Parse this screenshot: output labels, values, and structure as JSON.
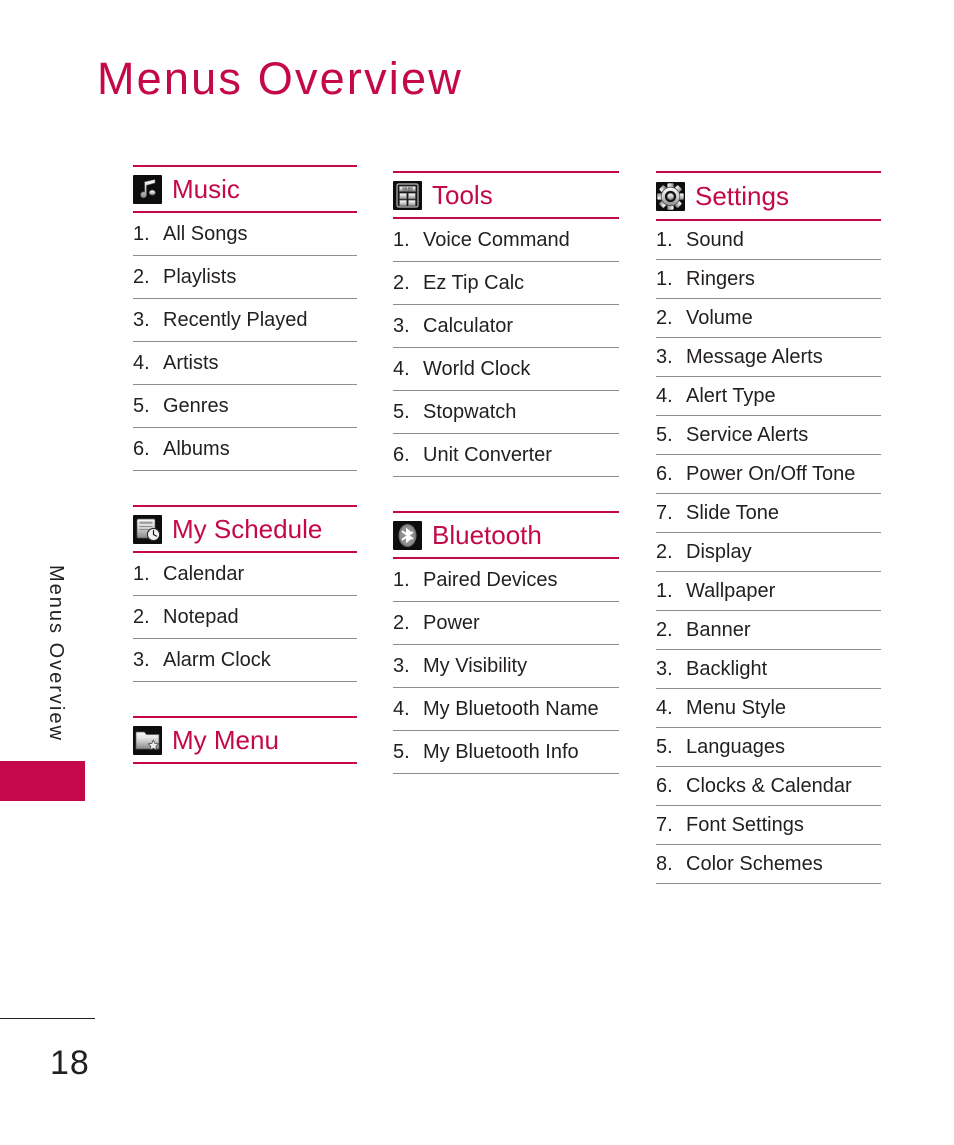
{
  "page": {
    "title": "Menus Overview",
    "running_head": "Menus Overview",
    "page_number": "18",
    "accent_color": "#C4084A",
    "text_color": "#231F20",
    "rule_color": "#8E8E8E"
  },
  "columns": [
    {
      "id": "column-1",
      "sections": [
        {
          "id": "music",
          "title": "Music",
          "icon": "music-note-icon",
          "items": [
            {
              "num": "1.",
              "label": "All Songs"
            },
            {
              "num": "2.",
              "label": "Playlists"
            },
            {
              "num": "3.",
              "label": "Recently Played"
            },
            {
              "num": "4.",
              "label": "Artists"
            },
            {
              "num": "5.",
              "label": "Genres"
            },
            {
              "num": "6.",
              "label": "Albums"
            }
          ]
        },
        {
          "id": "my-schedule",
          "title": "My Schedule",
          "icon": "calendar-clock-icon",
          "items": [
            {
              "num": "1.",
              "label": "Calendar"
            },
            {
              "num": "2.",
              "label": "Notepad"
            },
            {
              "num": "3.",
              "label": "Alarm Clock"
            }
          ]
        },
        {
          "id": "my-menu",
          "title": "My Menu",
          "icon": "folder-star-icon",
          "items": []
        }
      ]
    },
    {
      "id": "column-2",
      "sections": [
        {
          "id": "tools",
          "title": "Tools",
          "icon": "calculator-icon",
          "items": [
            {
              "num": "1.",
              "label": "Voice Command"
            },
            {
              "num": "2.",
              "label": "Ez Tip Calc"
            },
            {
              "num": "3.",
              "label": "Calculator"
            },
            {
              "num": "4.",
              "label": "World Clock"
            },
            {
              "num": "5.",
              "label": "Stopwatch"
            },
            {
              "num": "6.",
              "label": "Unit Converter"
            }
          ]
        },
        {
          "id": "bluetooth",
          "title": "Bluetooth",
          "icon": "bluetooth-icon",
          "items": [
            {
              "num": "1.",
              "label": "Paired Devices"
            },
            {
              "num": "2.",
              "label": "Power"
            },
            {
              "num": "3.",
              "label": "My Visibility"
            },
            {
              "num": "4.",
              "label": "My Bluetooth Name"
            },
            {
              "num": "5.",
              "label": "My Bluetooth Info"
            }
          ]
        }
      ]
    },
    {
      "id": "column-3",
      "sections": [
        {
          "id": "settings",
          "title": "Settings",
          "icon": "gear-icon",
          "items": [
            {
              "num": "1.",
              "label": "Sound",
              "level": 1
            },
            {
              "num": "1.",
              "label": "Ringers",
              "level": 2
            },
            {
              "num": "2.",
              "label": "Volume",
              "level": 2
            },
            {
              "num": "3.",
              "label": "Message Alerts",
              "level": 2
            },
            {
              "num": "4.",
              "label": "Alert Type",
              "level": 2
            },
            {
              "num": "5.",
              "label": "Service Alerts",
              "level": 2
            },
            {
              "num": "6.",
              "label": "Power On/Off Tone",
              "level": 2
            },
            {
              "num": "7.",
              "label": "Slide Tone",
              "level": 2
            },
            {
              "num": "2.",
              "label": "Display",
              "level": 1
            },
            {
              "num": "1.",
              "label": "Wallpaper",
              "level": 2
            },
            {
              "num": "2.",
              "label": "Banner",
              "level": 2
            },
            {
              "num": "3.",
              "label": "Backlight",
              "level": 2
            },
            {
              "num": "4.",
              "label": "Menu Style",
              "level": 2
            },
            {
              "num": "5.",
              "label": "Languages",
              "level": 2
            },
            {
              "num": "6.",
              "label": "Clocks & Calendar",
              "level": 2
            },
            {
              "num": "7.",
              "label": "Font Settings",
              "level": 2
            },
            {
              "num": "8.",
              "label": "Color Schemes",
              "level": 2
            }
          ]
        }
      ]
    }
  ]
}
